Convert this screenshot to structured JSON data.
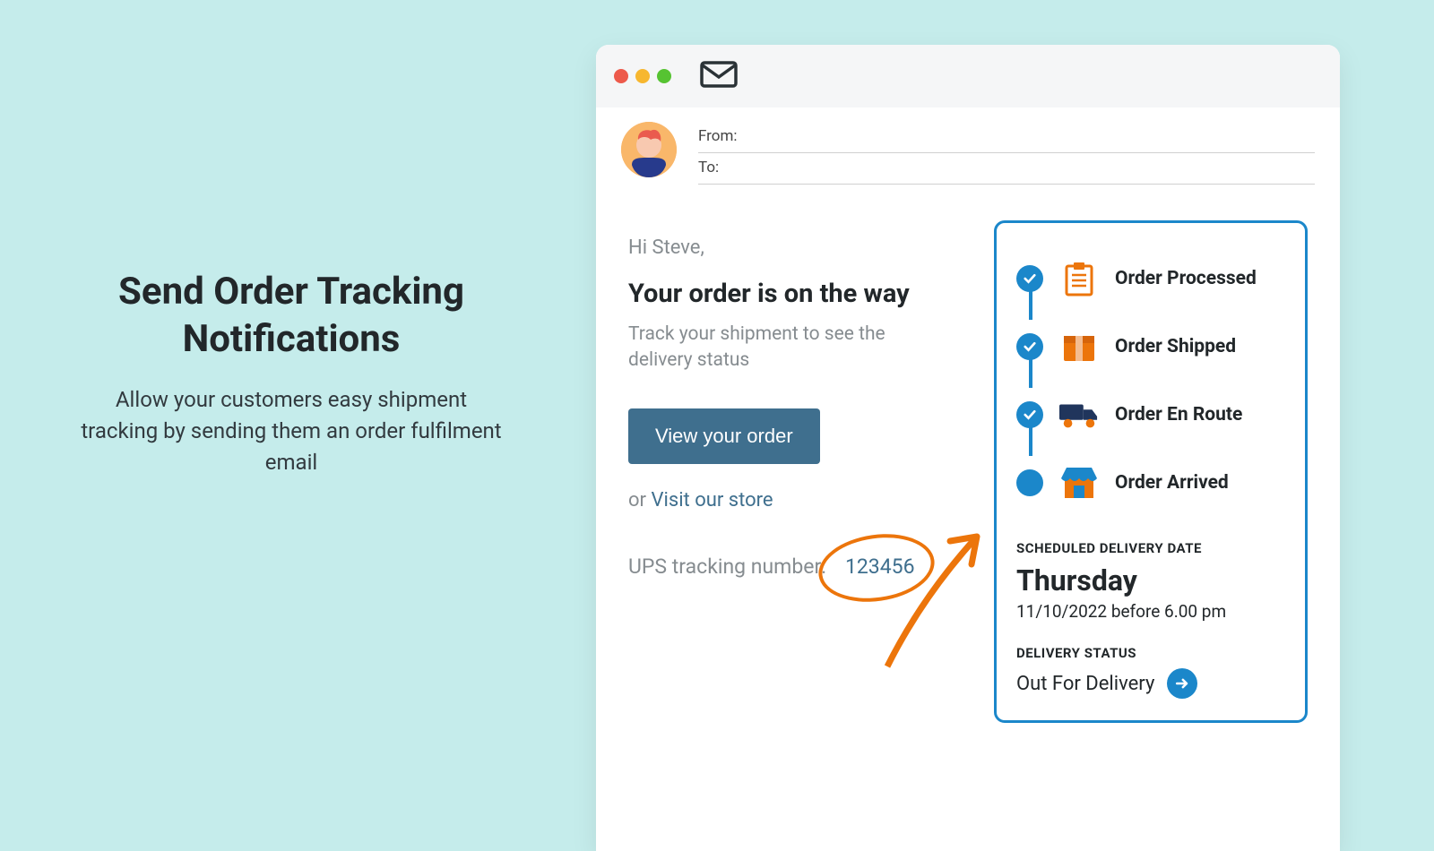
{
  "left": {
    "title": "Send Order Tracking Notifications",
    "subtitle": "Allow your customers easy shipment tracking by sending them an order fulfilment email"
  },
  "email": {
    "from_label": "From:",
    "to_label": "To:",
    "greeting": "Hi Steve,",
    "headline": "Your order is on the way",
    "subtext": "Track your shipment to see the delivery status",
    "view_button": "View your order",
    "or_text": "or",
    "visit_link": "Visit our store",
    "tracking_label": "UPS tracking number:",
    "tracking_number": "123456"
  },
  "tracking": {
    "steps": [
      {
        "label": "Order Processed",
        "done": true
      },
      {
        "label": "Order Shipped",
        "done": true
      },
      {
        "label": "Order En Route",
        "done": true
      },
      {
        "label": "Order Arrived",
        "done": false
      }
    ],
    "sched_label": "SCHEDULED DELIVERY DATE",
    "sched_day": "Thursday",
    "sched_detail": "11/10/2022 before 6.00 pm",
    "status_label": "DELIVERY STATUS",
    "status_value": "Out For Delivery"
  },
  "colors": {
    "accent_blue": "#1b87ca",
    "accent_orange": "#ec750b",
    "button_blue": "#3f6f8e"
  }
}
